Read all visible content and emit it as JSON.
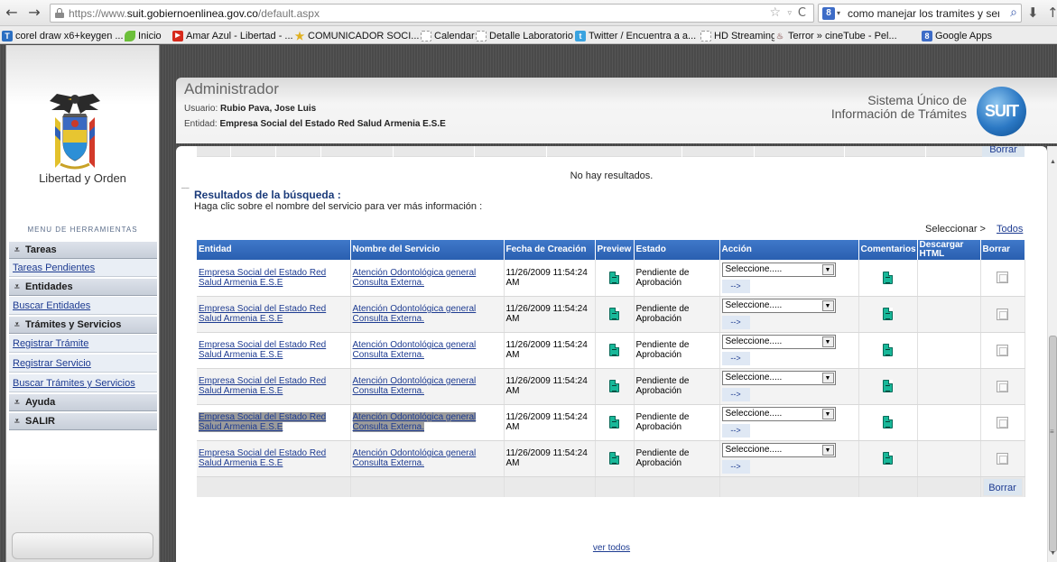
{
  "browser": {
    "url_prefix": "https://www.",
    "url_domain": "suit.gobiernoenlinea.gov.co",
    "url_path": "/default.aspx",
    "search_text": "como manejar los tramites y servic",
    "bookmarks": [
      {
        "label": "corel draw x6+keygen ...",
        "icon": "T",
        "color": "#2b6fc2"
      },
      {
        "label": "Inicio",
        "icon": "",
        "color": "#6cbf3a"
      },
      {
        "label": "Amar Azul - Libertad - ...",
        "icon": "▶",
        "color": "#d62a1c"
      },
      {
        "label": "COMUNICADOR SOCI...",
        "icon": "★",
        "color": "#e0b020"
      },
      {
        "label": "Calendar",
        "icon": "",
        "color": "#ffffff"
      },
      {
        "label": "Detalle Laboratorio",
        "icon": "",
        "color": "#ffffff"
      },
      {
        "label": "Twitter / Encuentra a a...",
        "icon": "t",
        "color": "#3aa3e0"
      },
      {
        "label": "HD Streaming",
        "icon": "",
        "color": "#ffffff"
      },
      {
        "label": "Terror » cineTube - Pel...",
        "icon": "",
        "color": "#ffffff"
      },
      {
        "label": "Google Apps",
        "icon": "8",
        "color": "#3d6cc7"
      }
    ]
  },
  "sidebar": {
    "motto": "Libertad y Orden",
    "menu_title": "MENU DE HERRAMIENTAS",
    "sections": {
      "tareas": "Tareas",
      "tareas_pendientes": "Tareas Pendientes",
      "entidades": "Entidades",
      "buscar_entidades": "Buscar Entidades",
      "tramites": "Trámites y Servicios",
      "registrar_tramite": "Registrar Trámite",
      "registrar_servicio": "Registrar Servicio",
      "buscar_tramites": "Buscar Trámites y Servicios",
      "ayuda": "Ayuda",
      "salir": "SALIR"
    }
  },
  "header": {
    "role": "Administrador",
    "user_label": "Usuario:",
    "user_name": "Rubio Pava, Jose Luis",
    "entity_label": "Entidad:",
    "entity_name": "Empresa Social del Estado Red Salud Armenia E.S.E",
    "system_line1": "Sistema Único de",
    "system_line2": "Información de Trámites",
    "logo_text": "SUIT"
  },
  "content": {
    "top_delete": "Borrar",
    "no_results": "No hay resultados.",
    "results_title": "Resultados de la búsqueda :",
    "results_hint": "Haga clic sobre el nombre del servicio para ver más información :",
    "select_label": "Seleccionar >",
    "select_all": "Todos",
    "columns": {
      "entidad": "Entidad",
      "servicio": "Nombre del Servicio",
      "fecha": "Fecha de Creación",
      "preview": "Preview",
      "estado": "Estado",
      "accion": "Acción",
      "comentarios": "Comentarios",
      "descargar": "Descargar HTML",
      "borrar": "Borrar"
    },
    "rows": [
      {
        "entidad": "Empresa Social del Estado Red Salud Armenia E.S.E",
        "servicio": "Atención Odontológica general Consulta Externa.",
        "fecha": "11/26/2009 11:54:24 AM",
        "estado": "Pendiente de Aprobación",
        "accion": "Seleccione.....",
        "go": "-->"
      },
      {
        "entidad": "Empresa Social del Estado Red Salud Armenia E.S.E",
        "servicio": "Atención Odontológica general Consulta Externa.",
        "fecha": "11/26/2009 11:54:24 AM",
        "estado": "Pendiente de Aprobación",
        "accion": "Seleccione.....",
        "go": "-->"
      },
      {
        "entidad": "Empresa Social del Estado Red Salud Armenia E.S.E",
        "servicio": "Atención Odontológica general Consulta Externa.",
        "fecha": "11/26/2009 11:54:24 AM",
        "estado": "Pendiente de Aprobación",
        "accion": "Seleccione.....",
        "go": "-->"
      },
      {
        "entidad": "Empresa Social del Estado Red Salud Armenia E.S.E",
        "servicio": "Atención Odontológica general Consulta Externa.",
        "fecha": "11/26/2009 11:54:24 AM",
        "estado": "Pendiente de Aprobación",
        "accion": "Seleccione.....",
        "go": "-->"
      },
      {
        "entidad": "Empresa Social del Estado Red Salud Armenia E.S.E",
        "servicio": "Atención Odontológica general Consulta Externa.",
        "fecha": "11/26/2009 11:54:24 AM",
        "estado": "Pendiente de Aprobación",
        "accion": "Seleccione.....",
        "go": "-->"
      },
      {
        "entidad": "Empresa Social del Estado Red Salud Armenia E.S.E",
        "servicio": "Atención Odontológica general Consulta Externa.",
        "fecha": "11/26/2009 11:54:24 AM",
        "estado": "Pendiente de Aprobación",
        "accion": "Seleccione.....",
        "go": "-->"
      }
    ],
    "bottom_delete": "Borrar",
    "view_all": "ver todos"
  }
}
